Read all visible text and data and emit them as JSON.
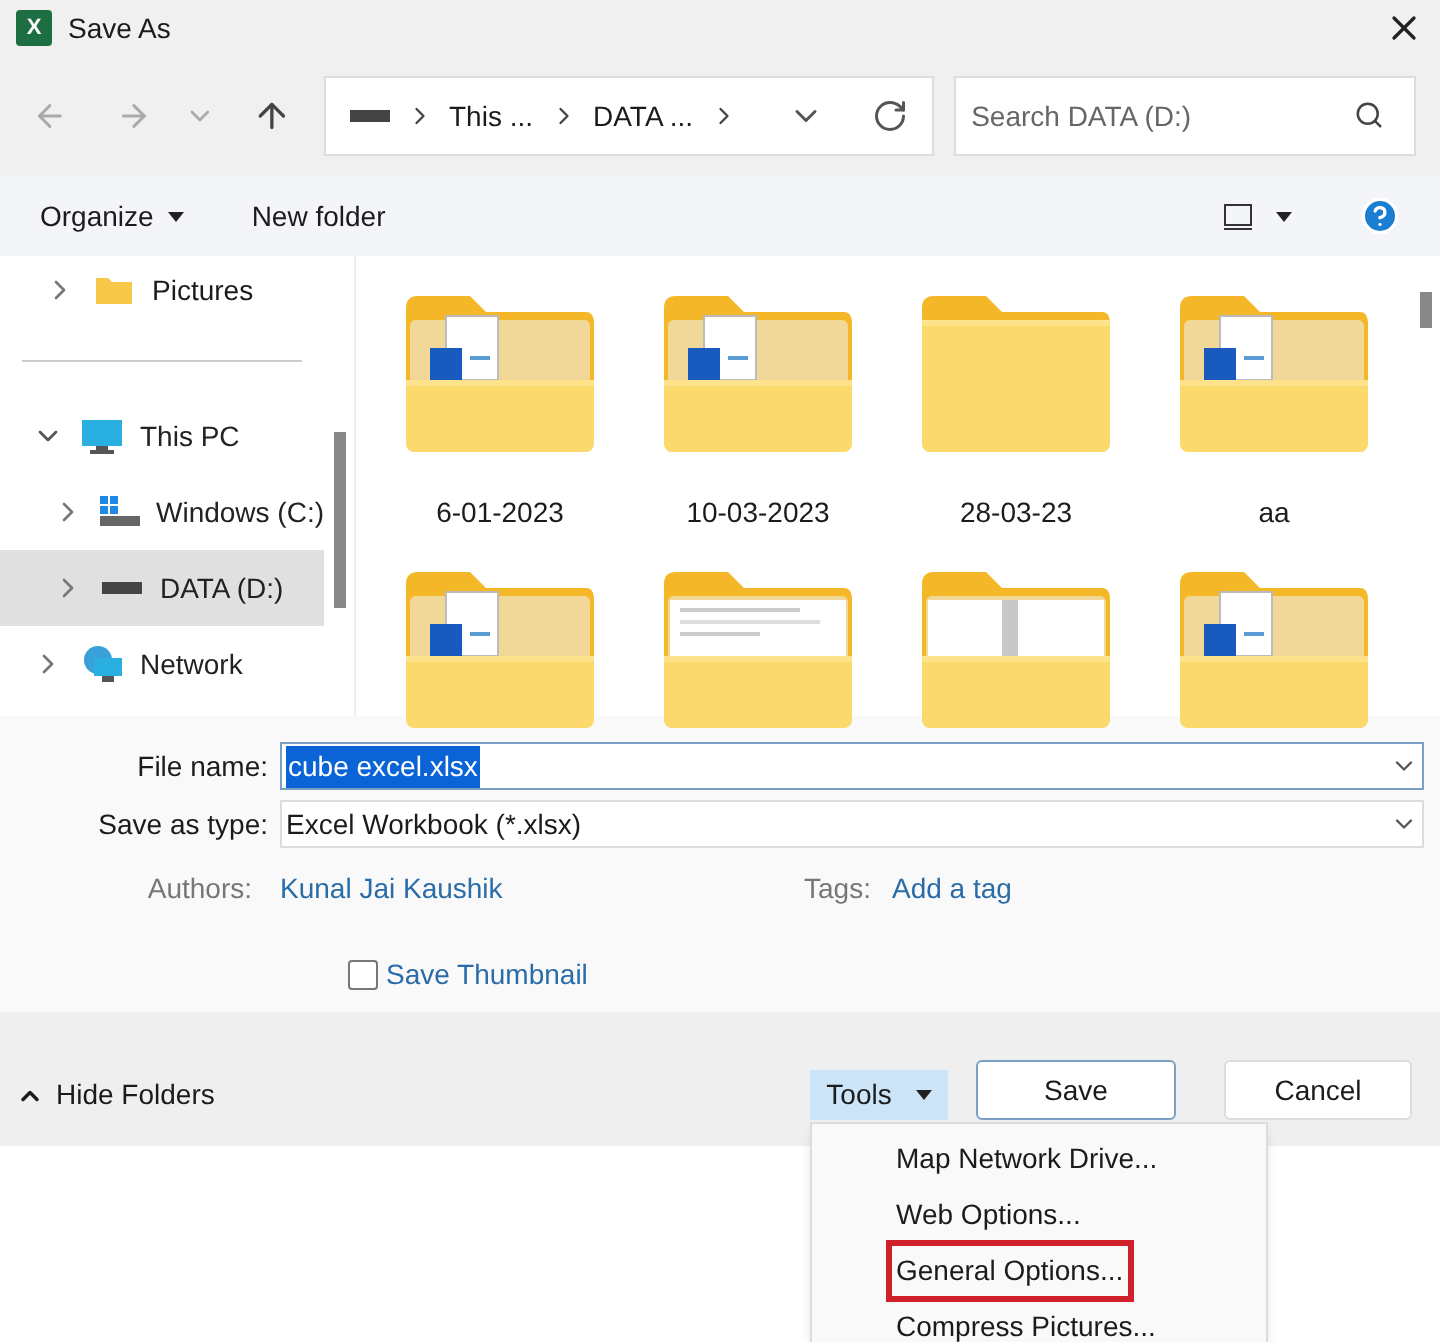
{
  "window": {
    "title": "Save As",
    "icon_letter": "X"
  },
  "address_bar": {
    "crumbs": [
      "This ...",
      "DATA ..."
    ]
  },
  "search": {
    "placeholder": "Search DATA (D:)"
  },
  "toolbar": {
    "organize": "Organize",
    "new_folder": "New folder"
  },
  "sidebar": {
    "quick_access": [
      {
        "label": "Pictures",
        "kind": "folder",
        "selected": false
      }
    ],
    "items": [
      {
        "label": "This PC",
        "kind": "pc",
        "expanded": true,
        "selected": false,
        "children": [
          {
            "label": "Windows (C:)",
            "kind": "windows-drive",
            "expanded": false,
            "selected": false
          },
          {
            "label": "DATA (D:)",
            "kind": "drive",
            "expanded": false,
            "selected": true
          }
        ]
      },
      {
        "label": "Network",
        "kind": "network",
        "expanded": false,
        "selected": false
      }
    ]
  },
  "folders": [
    {
      "label": "6-01-2023",
      "kind": "word"
    },
    {
      "label": "10-03-2023",
      "kind": "word"
    },
    {
      "label": "28-03-23",
      "kind": "empty"
    },
    {
      "label": "aa",
      "kind": "word"
    },
    {
      "kind": "word"
    },
    {
      "kind": "document"
    },
    {
      "kind": "split"
    },
    {
      "kind": "word"
    }
  ],
  "form": {
    "file_name_label": "File name:",
    "file_name": "cube excel.xlsx",
    "type_label": "Save as type:",
    "type": "Excel Workbook (*.xlsx)",
    "authors_label": "Authors:",
    "authors": "Kunal Jai Kaushik",
    "tags_label": "Tags:",
    "tags": "Add a tag",
    "thumbnail": {
      "label": "Save Thumbnail",
      "checked": false
    }
  },
  "footer": {
    "hide_folders": "Hide Folders",
    "tools": "Tools",
    "save": "Save",
    "cancel": "Cancel"
  },
  "tools_menu": [
    {
      "label": "Map Network Drive...",
      "highlighted": false
    },
    {
      "label": "Web Options...",
      "highlighted": false
    },
    {
      "label": "General Options...",
      "highlighted": true
    },
    {
      "label": "Compress Pictures...",
      "highlighted": false
    }
  ]
}
